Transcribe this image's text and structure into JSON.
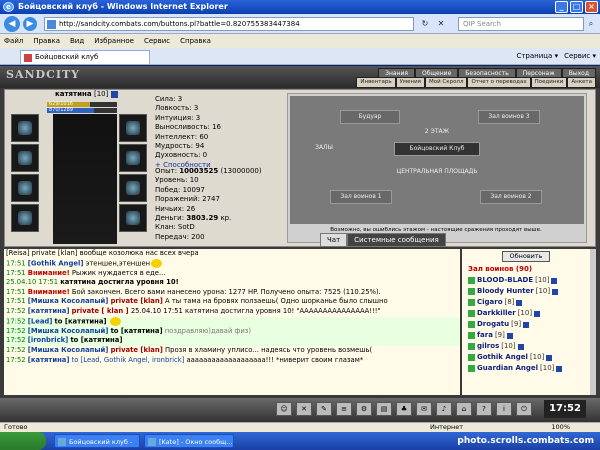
{
  "window": {
    "title": "Бойцовский клуб - Windows Internet Explorer",
    "buttons": [
      "_",
      "□",
      "×"
    ]
  },
  "addressbar": {
    "url": "http://sandcity.combats.com/buttons.pl?battle=0.820755383447384",
    "search_placeholder": "QIP Search",
    "back": "◀",
    "forward": "▶"
  },
  "menu": [
    "Файл",
    "Правка",
    "Вид",
    "Избранное",
    "Сервис",
    "Справка"
  ],
  "tab": {
    "label": "Бойцовский клуб",
    "tools": [
      "Страница ▾",
      "Сервис ▾"
    ]
  },
  "game": {
    "logo": "SANDCITY",
    "top_nav": [
      "Знания",
      "Общение",
      "Безопасность",
      "Персонаж",
      "Выход"
    ],
    "sub_nav": [
      "Инвентарь",
      "Умения",
      "Мой Скролл",
      "Отчет о переводах",
      "Поединки",
      "Анкета"
    ]
  },
  "character": {
    "name": "катятина",
    "level": "[10]",
    "hp_text": "629/1016",
    "mp_text": "870/1289",
    "hp_fraction": 0.62,
    "mp_fraction": 0.67,
    "stats": [
      {
        "label": "Сила: 3"
      },
      {
        "label": "Ловкость: 3"
      },
      {
        "label": "Интуиция: 3"
      },
      {
        "label": "Выносливость: 16"
      },
      {
        "label": "Интеллект: 60"
      },
      {
        "label": "Мудрость: 94"
      },
      {
        "label": "Духовность: 0"
      }
    ],
    "abilities": "+ Способности",
    "info": {
      "exp_label": "Опыт:",
      "exp": "10003525",
      "exp_next": "(13000000)",
      "level": "Уровень: 10",
      "wins": "Побед: 10097",
      "losses": "Поражений: 2747",
      "draws": "Ничьих: 26",
      "money_label": "Деньги:",
      "money": "3803.29",
      "money_unit": "кр.",
      "clan": "Клан: SotD",
      "transfers": "Передач: 200"
    }
  },
  "map": {
    "rooms": [
      "Будуар",
      "Зал воинов 3",
      "2 ЭТАЖ",
      "Бойцовский Клуб",
      "ЗАЛЫ",
      "ЦЕНТРАЛЬНАЯ ПЛОЩАДЬ",
      "Зал воинов 1",
      "Зал воинов 2"
    ],
    "note": "Возможно, вы ошиблись этажом - настоящие сражения проходят выше."
  },
  "chat_tabs": [
    "Чат",
    "Системные сообщения"
  ],
  "chat": [
    {
      "time": "",
      "text": "[Reisa] private [klan] вообще козолюка нас всех вчера"
    },
    {
      "time": "17:51",
      "nick": "[Gothik Angel]",
      "text": "этеншен,этеншен"
    },
    {
      "time": "17:51",
      "warn": "Внимание!",
      "text": "Рыжик нуждается в еде..."
    },
    {
      "time": "25.04.10 17:51",
      "text": "катятина достигла уровня 10!"
    },
    {
      "time": "17:51",
      "warn": "Внимание!",
      "text": "Бой закончен. Всего вами нанесено урона: 1277 HP. Получено опыта: 7525 (110.25%)."
    },
    {
      "time": "17:51",
      "nick": "[Мишка Косолапый]",
      "priv": "private [klan]",
      "text": "А ты тама на бровях ползаешь( Одно шорканье было слышно"
    },
    {
      "time": "17:52",
      "nick": "[катятина]",
      "priv": "private [ klan ]",
      "text": "25.04.10 17:51 катятина достигла уровня 10! \"ААААААААААААААА!!!\""
    },
    {
      "time": "17:52",
      "nick": "[Lead]",
      "to": "to [катятина]",
      "text": ""
    },
    {
      "time": "17:52",
      "nick": "[Мишка Косолапый]",
      "to": "to [катятина]",
      "text": "поздравляю)давай физ)"
    },
    {
      "time": "17:52",
      "nick": "[ironbrick]",
      "to": "to [катятина]",
      "text": ""
    },
    {
      "time": "17:52",
      "nick": "[Мишка Косолапый]",
      "priv": "private [klan]",
      "text": "Прозя в хламину уплисо... надеясь что уровень возмешь("
    },
    {
      "time": "17:52",
      "nick": "[катятина]",
      "to": "to [Lead, Gothik Angel, ironbrick]",
      "text": "ааааааааааааааааааа!!! *ниверит своим глазам*"
    }
  ],
  "warriors": {
    "refresh": "Обновить",
    "title": "Зал воинов (90)",
    "list": [
      {
        "name": "BLOOD-BLADE",
        "level": "[10]"
      },
      {
        "name": "Bloody Hunter",
        "level": "[10]"
      },
      {
        "name": "Cigaro",
        "level": "[8]"
      },
      {
        "name": "Darkkiller",
        "level": "[10]"
      },
      {
        "name": "Drogatu",
        "level": "[9]"
      },
      {
        "name": "fara",
        "level": "[9]"
      },
      {
        "name": "gilros",
        "level": "[10]"
      },
      {
        "name": "Gothik Angel",
        "level": "[10]"
      },
      {
        "name": "Guardian Angel",
        "level": "[10]"
      }
    ]
  },
  "toolbar": {
    "clock": "17:52"
  },
  "statusbar": {
    "left": "Готово",
    "middle": "Интернет",
    "zoom": "100%"
  },
  "taskbar": {
    "tasks": [
      "Бойцовский клуб - ...",
      "[Kate] - Окно сообщ..."
    ],
    "watermark": "photo.scrolls.combats.com"
  }
}
